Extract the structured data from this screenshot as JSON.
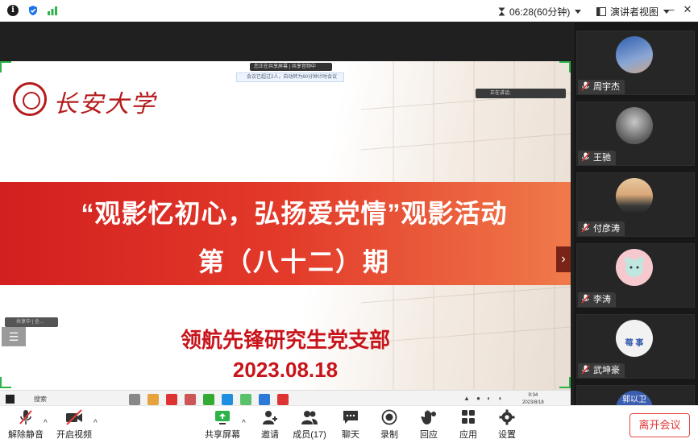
{
  "topbar": {
    "timer_text": "06:28(60分钟)",
    "view_label": "演讲者视图",
    "window_controls": [
      "minimize-icon",
      "restore-icon",
      "close-icon"
    ]
  },
  "shared_screen": {
    "share_status": "您正在共享屏幕  |  共享音频中",
    "notice": "会议已超过2人，自动转为60分钟计时会议",
    "speaking": "正在讲话:",
    "float_tag": "共享中 | 全...",
    "slide": {
      "university_name": "长安大学",
      "title_line1": "“观影忆初心，弘扬爱党情”观影活动",
      "title_line2": "第（八十二）期",
      "department": "领航先锋研究生党支部",
      "date": "2023.08.18"
    },
    "taskbar": {
      "search_label": "搜索",
      "clock_time": "9:34",
      "clock_date": "2023/8/18"
    }
  },
  "participants": [
    {
      "name": "周宇杰",
      "muted": true
    },
    {
      "name": "王驰",
      "muted": true
    },
    {
      "name": "付彦涛",
      "muted": true
    },
    {
      "name": "李涛",
      "muted": true
    },
    {
      "name": "武坤豪",
      "muted": true,
      "avatar_text": "莓 事"
    },
    {
      "avatar_text": "郭以卫"
    }
  ],
  "toolbar": {
    "unmute": "解除静音",
    "start_video": "开启视频",
    "share_screen": "共享屏幕",
    "invite": "邀请",
    "members": "成员(17)",
    "chat": "聊天",
    "record": "录制",
    "reactions": "回应",
    "apps": "应用",
    "settings": "设置",
    "leave": "离开会议"
  },
  "colors": {
    "accent_green": "#2db34a",
    "banner_red": "#d21f1f",
    "text_red": "#c8141b",
    "leave_red": "#e03535"
  }
}
